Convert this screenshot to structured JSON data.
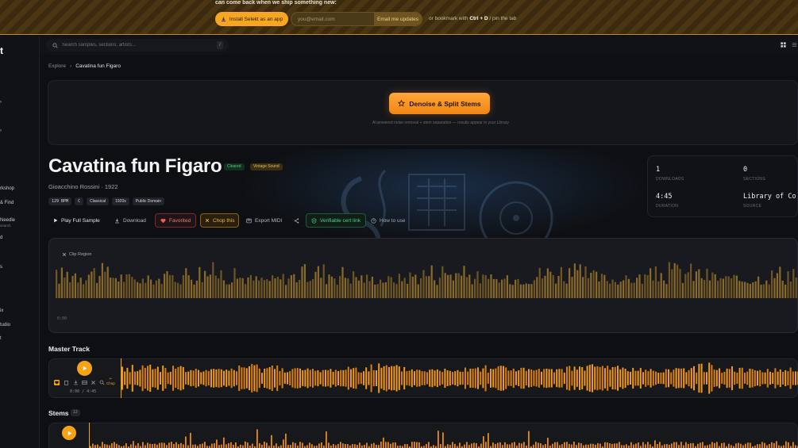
{
  "banner": {
    "text": "can come back when we ship something new:",
    "install_label": "Install Selekt as an app",
    "email_placeholder": "you@email.com",
    "email_button": "Email me updates",
    "bookmark_prefix": "or bookmark with",
    "bookmark_keys": "Ctrl + D",
    "bookmark_suffix": "/ pin the tab"
  },
  "sidebar": {
    "logo": "t",
    "items": [
      {
        "label": "rkshop"
      },
      {
        "label": "& Find"
      },
      {
        "label": "Needle",
        "sub": "search"
      },
      {
        "label": "d"
      },
      {
        "label": "s"
      },
      {
        "label": "ix"
      },
      {
        "label": "tudio"
      },
      {
        "label": "t"
      }
    ]
  },
  "search": {
    "placeholder": "Search samples, sections, artists...",
    "shortcut": "/"
  },
  "breadcrumb": {
    "root": "Explore",
    "separator": "›",
    "current": "Cavatina fun Figaro"
  },
  "denoise": {
    "button_label": "Denoise & Split Stems",
    "note": "AI-powered noise removal + stem separation — results appear in your Library"
  },
  "track": {
    "title": "Cavatina fun Figaro",
    "badge_cleared": "Cleared",
    "badge_vintage": "Vintage Sound",
    "artist_line": "Gioacchino Rossini · 1922",
    "tags": [
      "129 BPM",
      "C",
      "Classical",
      "1920s",
      "Public Domain"
    ]
  },
  "actions": {
    "play": "Play Full Sample",
    "download": "Download",
    "favorited": "Favorited",
    "chop": "Chop this",
    "export_midi": "Export MIDI",
    "cert": "Verifiable cert link",
    "how_to": "How to use"
  },
  "stats": {
    "downloads_value": "1",
    "downloads_label": "DOWNLOADS",
    "sections_value": "0",
    "sections_label": "SECTIONS",
    "duration_value": "4:45",
    "duration_label": "DURATION",
    "source_value": "Library of Co",
    "source_label": "SOURCE"
  },
  "clip": {
    "label": "Clip Region",
    "time": "0:00"
  },
  "master": {
    "title": "Master Track",
    "time": "0:00 / 4:45",
    "chop_label": "Chop"
  },
  "stems": {
    "title": "Stems",
    "count": "13"
  },
  "colors": {
    "accent": "#f6a316",
    "background": "#0e0f12",
    "green": "#53c783",
    "favorite": "#f07b7b"
  }
}
